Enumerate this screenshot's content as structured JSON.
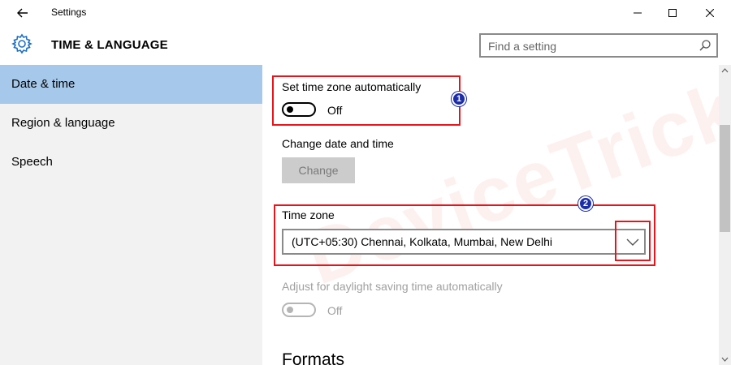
{
  "window": {
    "title": "Settings",
    "controls": {
      "minimize": "minimize-icon",
      "maximize": "maximize-icon",
      "close": "close-icon"
    }
  },
  "header": {
    "title": "TIME & LANGUAGE",
    "search_placeholder": "Find a setting"
  },
  "sidebar": {
    "items": [
      {
        "label": "Date & time",
        "active": true
      },
      {
        "label": "Region & language",
        "active": false
      },
      {
        "label": "Speech",
        "active": false
      }
    ]
  },
  "content": {
    "auto_timezone": {
      "label": "Set time zone automatically",
      "state": "Off"
    },
    "change_date_time": {
      "label": "Change date and time",
      "button": "Change"
    },
    "time_zone": {
      "label": "Time zone",
      "value": "(UTC+05:30) Chennai, Kolkata, Mumbai, New Delhi"
    },
    "daylight": {
      "label": "Adjust for daylight saving time automatically",
      "state": "Off"
    },
    "formats_heading": "Formats"
  },
  "annotations": {
    "badge1": "1",
    "badge2": "2",
    "watermark": "DeviceTricks"
  },
  "colors": {
    "highlight_red": "#e8141b",
    "badge_blue": "#1b2da8",
    "active_nav": "#a6c8ea",
    "sidebar_bg": "#f2f2f2"
  }
}
